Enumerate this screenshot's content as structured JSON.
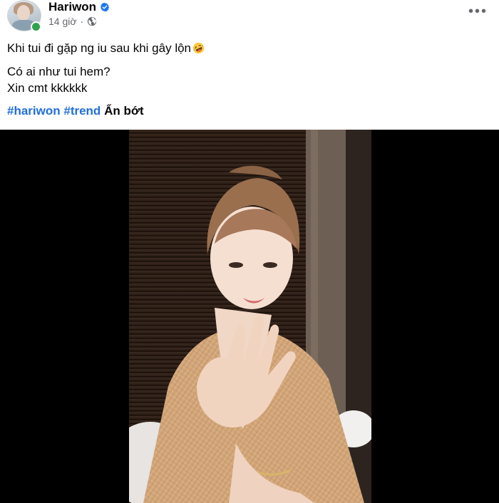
{
  "post": {
    "author": "Hariwon",
    "verified": true,
    "time": "14 giờ",
    "separator": "·",
    "privacy_icon": "globe-icon",
    "more_icon": "more-options-icon",
    "lines": {
      "line1": "Khi tui đi gặp ng iu sau khi gây lộn",
      "line2": "Có ai như tui hem?",
      "line3": "Xin cmt kkkkkk"
    },
    "emoji": "rolling-on-floor-laughing-emoji",
    "hashtags": [
      "#hariwon",
      "#trend"
    ],
    "see_less": "Ẩn bớt"
  },
  "colors": {
    "link": "#216fdb",
    "online": "#31a24c",
    "verified": "#1877f2",
    "secondary_text": "#65676b"
  },
  "media": {
    "type": "video",
    "description_icon": "video-frame"
  }
}
